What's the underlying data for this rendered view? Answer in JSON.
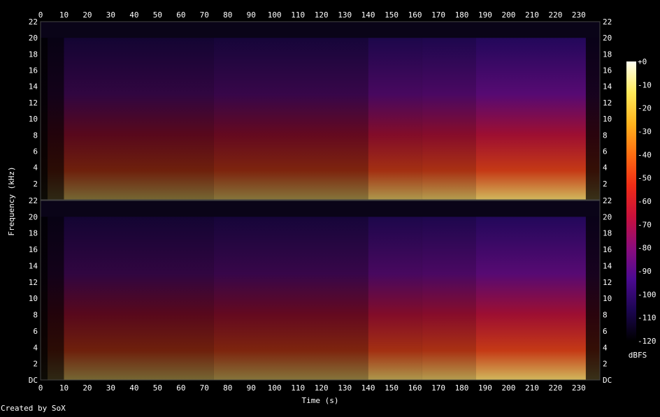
{
  "credit": "Created by SoX",
  "chart_data": {
    "type": "heatmap",
    "xlabel": "Time (s)",
    "ylabel": "Frequency (kHz)",
    "colorbar_label": "dBFS",
    "xlim": [
      0,
      239
    ],
    "x_ticks": [
      0,
      10,
      20,
      30,
      40,
      50,
      60,
      70,
      80,
      90,
      100,
      110,
      120,
      130,
      140,
      150,
      160,
      170,
      180,
      190,
      200,
      210,
      220,
      230
    ],
    "channels": [
      {
        "channel": 1,
        "ylim": [
          0,
          22
        ],
        "left_ticks": [
          "2",
          "4",
          "6",
          "8",
          "10",
          "12",
          "14",
          "16",
          "18",
          "20",
          "22"
        ],
        "right_ticks": [
          "2",
          "4",
          "6",
          "8",
          "10",
          "12",
          "14",
          "16",
          "18",
          "20",
          "22"
        ]
      },
      {
        "channel": 2,
        "ylim": [
          0,
          22
        ],
        "left_ticks": [
          "DC",
          "2",
          "4",
          "6",
          "8",
          "10",
          "12",
          "14",
          "16",
          "18",
          "20",
          "22"
        ],
        "right_ticks": [
          "DC",
          "2",
          "4",
          "6",
          "8",
          "10",
          "12",
          "14",
          "16",
          "18",
          "20",
          "22"
        ]
      }
    ],
    "colorbar": {
      "range": [
        -120,
        0
      ],
      "ticks": [
        "+0",
        "-10",
        "-20",
        "-30",
        "-40",
        "-50",
        "-60",
        "-70",
        "-80",
        "-90",
        "-100",
        "-110",
        "-120"
      ],
      "colors": [
        "#fffff0",
        "#ffea5a",
        "#ffb41e",
        "#ff6e12",
        "#f02c16",
        "#c8103c",
        "#8c0c7c",
        "#4c0a92",
        "#1c0652",
        "#000000"
      ]
    },
    "bandwidth_cutoff_khz": 20,
    "segments": [
      {
        "start": 0,
        "end": 3,
        "intensity": 0.05
      },
      {
        "start": 3,
        "end": 10,
        "intensity": 0.18
      },
      {
        "start": 10,
        "end": 74,
        "intensity": 0.46
      },
      {
        "start": 74,
        "end": 140,
        "intensity": 0.52
      },
      {
        "start": 140,
        "end": 163,
        "intensity": 0.68
      },
      {
        "start": 163,
        "end": 186,
        "intensity": 0.7
      },
      {
        "start": 186,
        "end": 233,
        "intensity": 0.82
      },
      {
        "start": 233,
        "end": 239,
        "intensity": 0.22
      }
    ]
  }
}
